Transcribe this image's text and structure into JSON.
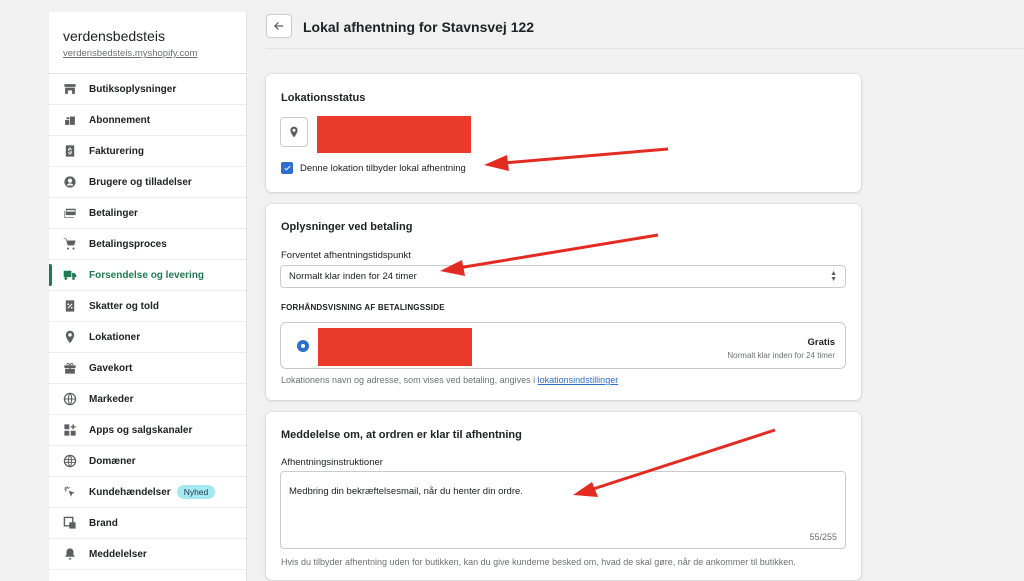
{
  "sidebar": {
    "store_name": "verdensbedsteis",
    "store_url": "verdensbedsteis.myshopify.com",
    "items": [
      {
        "label": "Butiksoplysninger",
        "icon": "store-icon"
      },
      {
        "label": "Abonnement",
        "icon": "plan-icon"
      },
      {
        "label": "Fakturering",
        "icon": "billing-icon"
      },
      {
        "label": "Brugere og tilladelser",
        "icon": "user-icon"
      },
      {
        "label": "Betalinger",
        "icon": "payments-icon"
      },
      {
        "label": "Betalingsproces",
        "icon": "cart-icon"
      },
      {
        "label": "Forsendelse og levering",
        "icon": "truck-icon",
        "active": true
      },
      {
        "label": "Skatter og told",
        "icon": "tax-icon"
      },
      {
        "label": "Lokationer",
        "icon": "location-icon"
      },
      {
        "label": "Gavekort",
        "icon": "gift-icon"
      },
      {
        "label": "Markeder",
        "icon": "globe-icon"
      },
      {
        "label": "Apps og salgskanaler",
        "icon": "apps-icon"
      },
      {
        "label": "Domæner",
        "icon": "domain-icon"
      },
      {
        "label": "Kundehændelser",
        "icon": "cursor-icon",
        "badge": "Nyhed"
      },
      {
        "label": "Brand",
        "icon": "brand-icon"
      },
      {
        "label": "Meddelelser",
        "icon": "bell-icon"
      }
    ]
  },
  "header": {
    "title": "Lokal afhentning for Stavnsvej 122"
  },
  "location_status": {
    "title": "Lokationsstatus",
    "checkbox_label": "Denne lokation tilbyder lokal afhentning",
    "checked": true
  },
  "checkout_info": {
    "title": "Oplysninger ved betaling",
    "expected_label": "Forventet afhentningstidspunkt",
    "expected_value": "Normalt klar inden for 24 timer",
    "preview_heading": "FORHÅNDSVISNING AF BETALINGSSIDE",
    "preview_price": "Gratis",
    "preview_sub": "Normalt klar inden for 24 timer",
    "help_prefix": "Lokationens navn og adresse, som vises ved betaling, angives i ",
    "help_link": "lokationsindstillinger"
  },
  "ready_notice": {
    "title": "Meddelelse om, at ordren er klar til afhentning",
    "instructions_label": "Afhentningsinstruktioner",
    "instructions_value": "Medbring din bekræftelsesmail, når du henter din ordre.",
    "char_count": "55/255",
    "help": "Hvis du tilbyder afhentning uden for butikken, kan du give kunderne besked om, hvad de skal gøre, når de ankommer til butikken."
  },
  "colors": {
    "accent": "#2c6ecb",
    "active_nav": "#1f7a50",
    "redaction": "#ea3b2a",
    "annotation_arrow": "#e32b22"
  }
}
